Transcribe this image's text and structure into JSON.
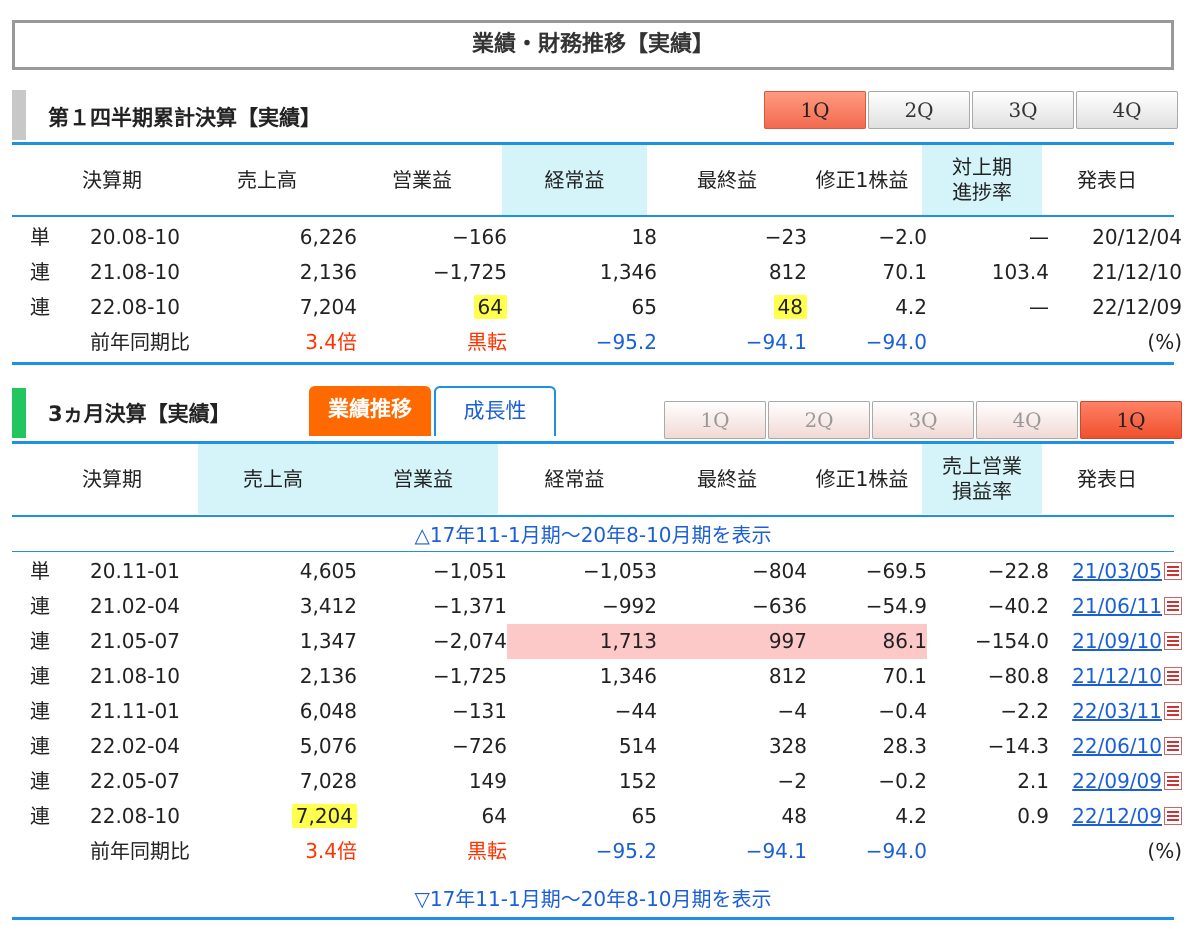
{
  "page_title": "業績・財務推移【実績】",
  "q1_section": {
    "title": "第１四半期累計決算【実績】",
    "tabs": [
      "1Q",
      "2Q",
      "3Q",
      "4Q"
    ],
    "headers": [
      "決算期",
      "売上高",
      "営業益",
      "経常益",
      "最終益",
      "修正1株益",
      "対上期\n進捗率",
      "発表日"
    ],
    "rows": [
      {
        "type": "単",
        "period": "20.08-10",
        "sales": "6,226",
        "op": "−166",
        "ord": "18",
        "net": "−23",
        "eps": "−2.0",
        "progress": "—",
        "date": "20/12/04"
      },
      {
        "type": "連",
        "period": "21.08-10",
        "sales": "2,136",
        "op": "−1,725",
        "ord": "1,346",
        "net": "812",
        "eps": "70.1",
        "progress": "103.4",
        "date": "21/12/10"
      },
      {
        "type": "連",
        "period": "22.08-10",
        "sales": "7,204",
        "op": "64",
        "ord": "65",
        "net": "48",
        "eps": "4.2",
        "progress": "—",
        "date": "22/12/09"
      }
    ],
    "yoy": {
      "label": "前年同期比",
      "sales": "3.4倍",
      "op": "黒転",
      "ord": "−95.2",
      "net": "−94.1",
      "eps": "−94.0",
      "unit": "(%)"
    }
  },
  "q3m_section": {
    "title": "3ヵ月決算【実績】",
    "tab_performance": "業績推移",
    "tab_growth": "成長性",
    "tabs": [
      "1Q",
      "2Q",
      "3Q",
      "4Q",
      "1Q"
    ],
    "headers": [
      "決算期",
      "売上高",
      "営業益",
      "経常益",
      "最終益",
      "修正1株益",
      "売上営業\n損益率",
      "発表日"
    ],
    "show_toggle_up": "△17年11-1月期～20年8-10月期を表示",
    "show_toggle_down": "▽17年11-1月期～20年8-10月期を表示",
    "rows": [
      {
        "type": "単",
        "period": "20.11-01",
        "sales": "4,605",
        "op": "−1,051",
        "ord": "−1,053",
        "net": "−804",
        "eps": "−69.5",
        "margin": "−22.8",
        "date": "21/03/05"
      },
      {
        "type": "連",
        "period": "21.02-04",
        "sales": "3,412",
        "op": "−1,371",
        "ord": "−992",
        "net": "−636",
        "eps": "−54.9",
        "margin": "−40.2",
        "date": "21/06/11"
      },
      {
        "type": "連",
        "period": "21.05-07",
        "sales": "1,347",
        "op": "−2,074",
        "ord": "1,713",
        "net": "997",
        "eps": "86.1",
        "margin": "−154.0",
        "date": "21/09/10"
      },
      {
        "type": "連",
        "period": "21.08-10",
        "sales": "2,136",
        "op": "−1,725",
        "ord": "1,346",
        "net": "812",
        "eps": "70.1",
        "margin": "−80.8",
        "date": "21/12/10"
      },
      {
        "type": "連",
        "period": "21.11-01",
        "sales": "6,048",
        "op": "−131",
        "ord": "−44",
        "net": "−4",
        "eps": "−0.4",
        "margin": "−2.2",
        "date": "22/03/11"
      },
      {
        "type": "連",
        "period": "22.02-04",
        "sales": "5,076",
        "op": "−726",
        "ord": "514",
        "net": "328",
        "eps": "28.3",
        "margin": "−14.3",
        "date": "22/06/10"
      },
      {
        "type": "連",
        "period": "22.05-07",
        "sales": "7,028",
        "op": "149",
        "ord": "152",
        "net": "−2",
        "eps": "−0.2",
        "margin": "2.1",
        "date": "22/09/09"
      },
      {
        "type": "連",
        "period": "22.08-10",
        "sales": "7,204",
        "op": "64",
        "ord": "65",
        "net": "48",
        "eps": "4.2",
        "margin": "0.9",
        "date": "22/12/09"
      }
    ],
    "yoy": {
      "label": "前年同期比",
      "sales": "3.4倍",
      "op": "黒転",
      "ord": "−95.2",
      "net": "−94.1",
      "eps": "−94.0",
      "unit": "(%)"
    }
  },
  "colors": {
    "accent_blue": "#1e90e6",
    "highlight_yellow": "#ffff4d",
    "highlight_pink": "#fcc8c8",
    "orange_tab": "#ff6a00"
  }
}
